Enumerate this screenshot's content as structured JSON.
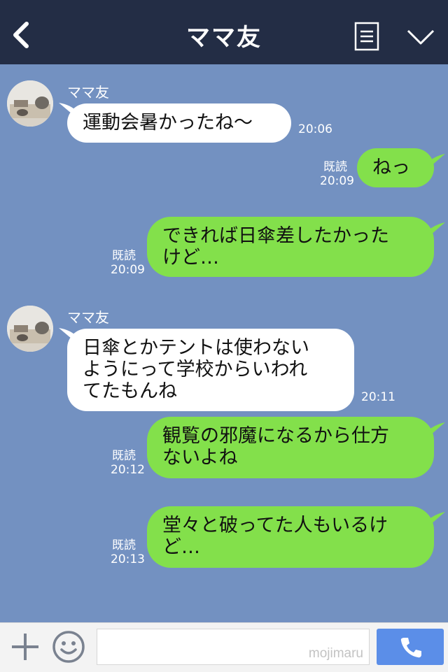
{
  "header": {
    "title": "ママ友"
  },
  "messages": [
    {
      "sender": "ママ友",
      "text": "運動会暑かったね〜",
      "time": "20:06"
    },
    {
      "read": "既読",
      "text": "ねっ",
      "time": "20:09"
    },
    {
      "read": "既読",
      "text": "できれば日傘差したかった\nけど…",
      "time": "20:09"
    },
    {
      "sender": "ママ友",
      "text": "日傘とかテントは使わない\nようにって学校からいわれ\nてたもんね",
      "time": "20:11"
    },
    {
      "read": "既読",
      "text": "観覧の邪魔になるから仕方\nないよね",
      "time": "20:12"
    },
    {
      "read": "既読",
      "text": "堂々と破ってた人もいるけ\nど…",
      "time": "20:13"
    }
  ],
  "footer": {
    "watermark": "mojimaru"
  },
  "colors": {
    "header_bg": "#232d45",
    "chat_bg": "#7391c1",
    "outgoing_bubble": "#83e04b",
    "incoming_bubble": "#ffffff",
    "call_button": "#5b8ee8"
  },
  "icons": [
    "back-icon",
    "menu-icon",
    "chevron-down-icon",
    "plus-icon",
    "smile-icon",
    "phone-icon"
  ]
}
